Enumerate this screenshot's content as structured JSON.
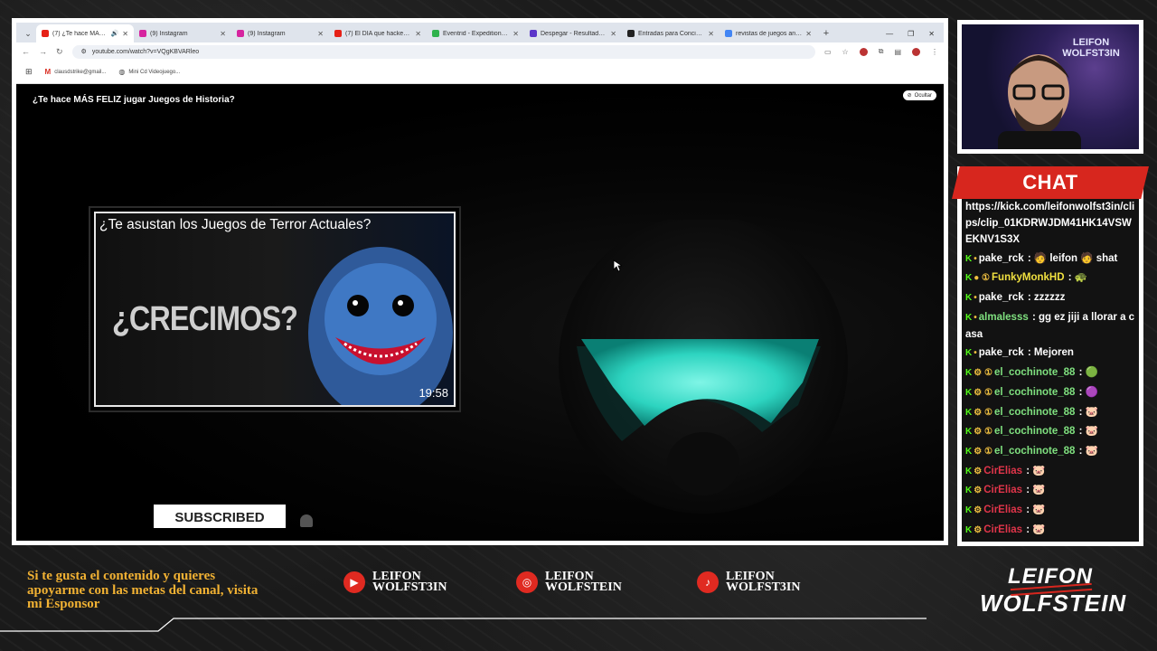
{
  "browser": {
    "tabs": [
      {
        "label": "(7) ¿Te hace MÁS FELI",
        "icon": "youtube-icon",
        "color": "#e62117",
        "active": true
      },
      {
        "label": "(9) Instagram",
        "icon": "instagram-icon",
        "color": "#d6249f"
      },
      {
        "label": "(9) Instagram",
        "icon": "instagram-icon",
        "color": "#d6249f"
      },
      {
        "label": "(7) El DÍA que hackearon",
        "icon": "youtube-icon",
        "color": "#e62117"
      },
      {
        "label": "Eventrid - Expedition 33",
        "icon": "eventrid-icon",
        "color": "#2fb24c"
      },
      {
        "label": "Despegar - Resultados de",
        "icon": "despegar-icon",
        "color": "#5b35c9"
      },
      {
        "label": "Entradas para Concierto",
        "icon": "ticket-icon",
        "color": "#222222"
      },
      {
        "label": "revistas de juegos antiguo",
        "icon": "google-icon",
        "color": "#4285f4"
      }
    ],
    "url": "youtube.com/watch?v=VQgKBVARleo",
    "bookmarks": [
      "clausdstrike@gmail...",
      "Mini Cd Videojuego..."
    ]
  },
  "video": {
    "title": "¿Te hace MÁS FELIZ jugar Juegos de Historia?",
    "hide_label": "Ocultar",
    "endcard": {
      "title": "¿Te asustan los Juegos de Terror Actuales?",
      "big_text": "¿CRECIMOS?",
      "duration": "19:58"
    },
    "subscribe_label": "SUBSCRIBED"
  },
  "chat": {
    "header": "CHAT",
    "messages": [
      {
        "user": "",
        "text": "https://kick.com/leifonwolfst3in/clips/clip_01KDRWJDM41HK14VSWEKNV1S3X",
        "color": "#ffffff",
        "badges": ""
      },
      {
        "user": "pake_rck",
        "text": " : 🧑 leifon 🧑 shat",
        "color": "#ffffff",
        "badges": "K •"
      },
      {
        "user": "FunkyMonkHD",
        "text": " : 🐢",
        "color": "#f0e040",
        "badges": "K ● ①"
      },
      {
        "user": "pake_rck",
        "text": " : zzzzzz",
        "color": "#ffffff",
        "badges": "K •"
      },
      {
        "user": "almalesss",
        "text": " : gg ez jiji a llorar a casa",
        "color": "#7fe07f",
        "badges": "K •"
      },
      {
        "user": "pake_rck",
        "text": " : Mejoren",
        "color": "#ffffff",
        "badges": "K •"
      },
      {
        "user": "el_cochinote_88",
        "text": " : 🟢",
        "color": "#7fe07f",
        "badges": "K ⚙ ①"
      },
      {
        "user": "el_cochinote_88",
        "text": " : 🟣",
        "color": "#7fe07f",
        "badges": "K ⚙ ①"
      },
      {
        "user": "el_cochinote_88",
        "text": " : 🐷",
        "color": "#7fe07f",
        "badges": "K ⚙ ①"
      },
      {
        "user": "el_cochinote_88",
        "text": " : 🐷",
        "color": "#7fe07f",
        "badges": "K ⚙ ①"
      },
      {
        "user": "el_cochinote_88",
        "text": " : 🐷",
        "color": "#7fe07f",
        "badges": "K ⚙ ①"
      },
      {
        "user": "CirElias",
        "text": " : 🐷",
        "color": "#e0354a",
        "badges": "K ⚙"
      },
      {
        "user": "CirElias",
        "text": " : 🐷",
        "color": "#e0354a",
        "badges": "K ⚙"
      },
      {
        "user": "CirElias",
        "text": " : 🐷",
        "color": "#e0354a",
        "badges": "K ⚙"
      },
      {
        "user": "CirElias",
        "text": " : 🐷",
        "color": "#e0354a",
        "badges": "K ⚙"
      },
      {
        "user": "pake_rck",
        "text": " : 🐸",
        "color": "#ffffff",
        "badges": "K •"
      }
    ]
  },
  "webcam": {
    "sign": "LEIFON WOLFST3IN"
  },
  "footer": {
    "promo_text": "Si te gusta el contenido y quieres apoyarme con las metas del canal, visita mi Esponsor",
    "socials": [
      {
        "icon": "youtube-icon",
        "line1": "LEIFON",
        "line2": "WOLFST3IN"
      },
      {
        "icon": "instagram-icon",
        "line1": "LEIFON",
        "line2": "WOLFSTEIN"
      },
      {
        "icon": "tiktok-icon",
        "line1": "LEIFON",
        "line2": "WOLFST3IN"
      }
    ],
    "logo_line1": "LEIFON",
    "logo_line2": "WOLFSTEIN"
  },
  "colors": {
    "accent_red": "#d7261e",
    "promo_gold": "#f2b233",
    "kick_green": "#53fc18"
  }
}
